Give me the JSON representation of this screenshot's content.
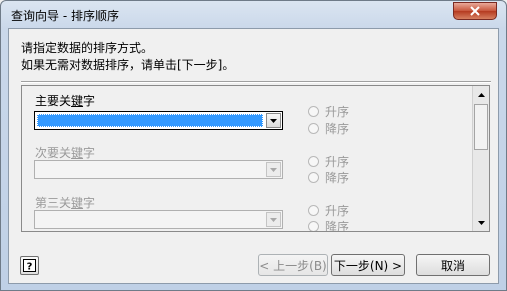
{
  "window": {
    "title": "查询向导 - 排序顺序",
    "close_icon": "close-icon"
  },
  "instructions": {
    "line1": "请指定数据的排序方式。",
    "line2": "如果无需对数据排序，请单击[下一步]。"
  },
  "sort_keys": [
    {
      "label_before": "主要关",
      "label_underlined": "键",
      "label_after": "字",
      "value": "",
      "enabled": true,
      "ascending": "升序",
      "descending": "降序"
    },
    {
      "label_before": "次要关",
      "label_underlined": "键",
      "label_after": "字",
      "value": "",
      "enabled": false,
      "ascending": "升序",
      "descending": "降序"
    },
    {
      "label_before": "第三关",
      "label_underlined": "键",
      "label_after": "字",
      "value": "",
      "enabled": false,
      "ascending": "升序",
      "descending": "降序"
    }
  ],
  "buttons": {
    "help_icon": "help-icon",
    "back": "< 上一步(B)",
    "next": "下一步(N) >",
    "cancel": "取消"
  },
  "colors": {
    "selection": "#3399ff",
    "disabled_text": "#9a9a9a",
    "close_red": "#c7553b"
  }
}
